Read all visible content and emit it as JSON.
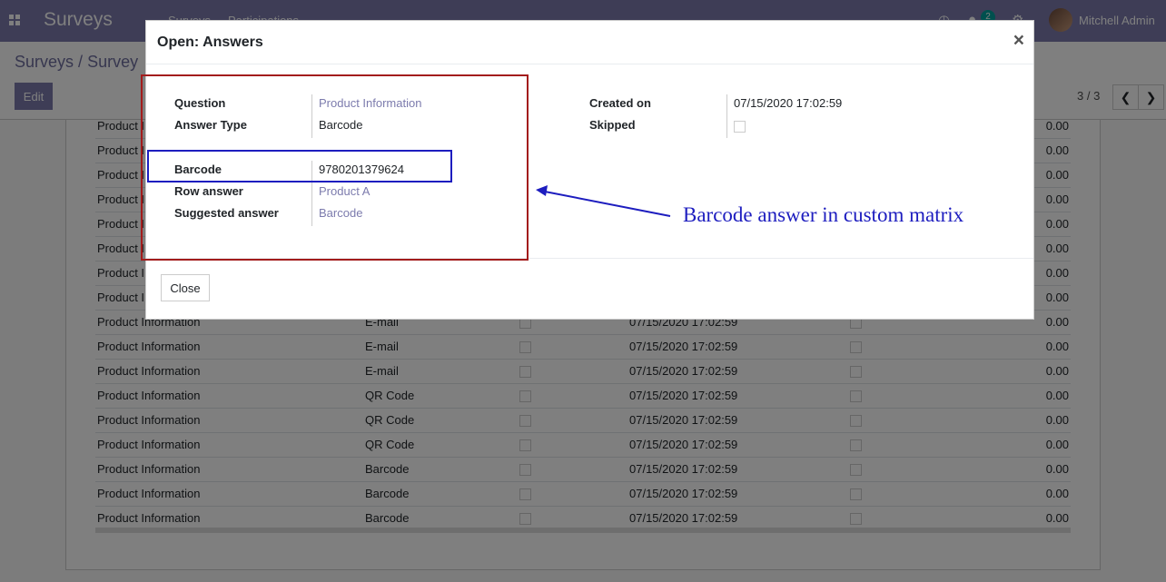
{
  "navbar": {
    "brand": "Surveys",
    "menu": [
      "Surveys",
      "Participations"
    ],
    "message_count": "2",
    "user_name": "Mitchell Admin"
  },
  "control": {
    "breadcrumb_root": "Surveys",
    "breadcrumb_sep": "/",
    "breadcrumb_current": "Survey",
    "edit_label": "Edit",
    "pager": "3 / 3"
  },
  "background_rows": [
    {
      "question": "Product I",
      "type": "",
      "date": "",
      "value": "0.00"
    },
    {
      "question": "Product I",
      "type": "",
      "date": "",
      "value": "0.00"
    },
    {
      "question": "Product I",
      "type": "",
      "date": "",
      "value": "0.00"
    },
    {
      "question": "Product I",
      "type": "",
      "date": "",
      "value": "0.00"
    },
    {
      "question": "Product I",
      "type": "",
      "date": "",
      "value": "0.00"
    },
    {
      "question": "Product I",
      "type": "",
      "date": "",
      "value": "0.00"
    },
    {
      "question": "Product I",
      "type": "",
      "date": "",
      "value": "0.00"
    },
    {
      "question": "Product I",
      "type": "",
      "date": "",
      "value": "0.00"
    },
    {
      "question": "Product Information",
      "type": "E-mail",
      "date": "07/15/2020 17:02:59",
      "value": "0.00"
    },
    {
      "question": "Product Information",
      "type": "E-mail",
      "date": "07/15/2020 17:02:59",
      "value": "0.00"
    },
    {
      "question": "Product Information",
      "type": "E-mail",
      "date": "07/15/2020 17:02:59",
      "value": "0.00"
    },
    {
      "question": "Product Information",
      "type": "QR Code",
      "date": "07/15/2020 17:02:59",
      "value": "0.00"
    },
    {
      "question": "Product Information",
      "type": "QR Code",
      "date": "07/15/2020 17:02:59",
      "value": "0.00"
    },
    {
      "question": "Product Information",
      "type": "QR Code",
      "date": "07/15/2020 17:02:59",
      "value": "0.00"
    },
    {
      "question": "Product Information",
      "type": "Barcode",
      "date": "07/15/2020 17:02:59",
      "value": "0.00"
    },
    {
      "question": "Product Information",
      "type": "Barcode",
      "date": "07/15/2020 17:02:59",
      "value": "0.00"
    },
    {
      "question": "Product Information",
      "type": "Barcode",
      "date": "07/15/2020 17:02:59",
      "value": "0.00"
    }
  ],
  "modal": {
    "title": "Open: Answers",
    "close_x": "×",
    "fields": {
      "question_label": "Question",
      "question_value": "Product Information",
      "answer_type_label": "Answer Type",
      "answer_type_value": "Barcode",
      "barcode_label": "Barcode",
      "barcode_value": "9780201379624",
      "row_answer_label": "Row answer",
      "row_answer_value": "Product A",
      "suggested_label": "Suggested answer",
      "suggested_value": "Barcode",
      "created_label": "Created on",
      "created_value": "07/15/2020 17:02:59",
      "skipped_label": "Skipped"
    },
    "close_label": "Close"
  },
  "annotation": {
    "text": "Barcode answer in custom matrix",
    "color": "#1d1dbf",
    "box_color": "#a31c1c"
  }
}
